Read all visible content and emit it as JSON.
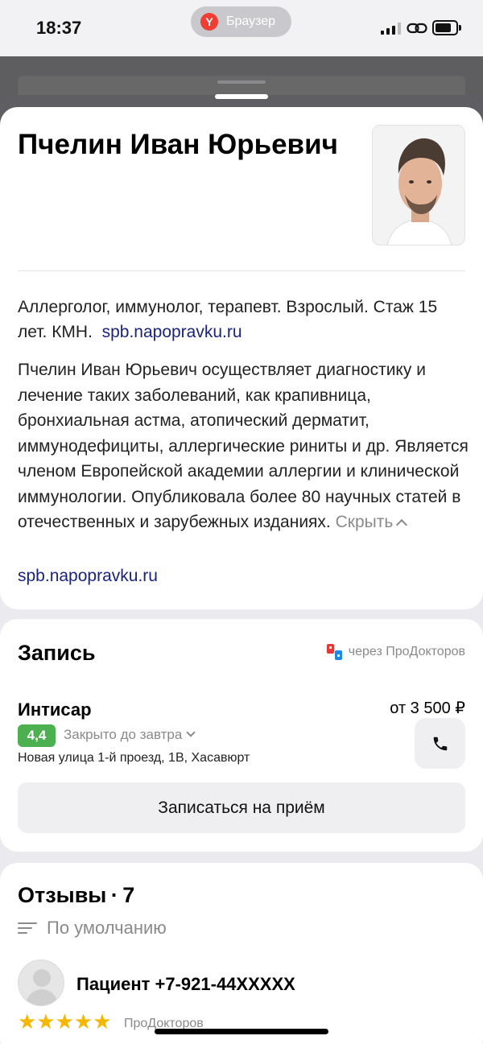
{
  "status_bar": {
    "time": "18:37",
    "browser_label": "Браузер",
    "browser_logo_letter": "Y"
  },
  "doctor": {
    "name": "Пчелин Иван Юрьевич",
    "specialty": "Аллерголог, иммунолог, терапевт. Взрослый. Стаж 15 лет. КМН.",
    "specialty_link": "spb.napopravku.ru",
    "bio": "Пчелин Иван Юрьевич осуществляет диагностику и лечение таких заболеваний, как крапивница, бронхиальная астма, атопический дерматит, иммунодефициты, аллергические риниты и др. Является членом Европейской академии аллергии и клинической иммунологии. Опубликовала более 80 научных статей в отечественных и зарубежных изданиях.",
    "hide_label": "Скрыть",
    "source_link": "spb.napopravku.ru"
  },
  "booking": {
    "title": "Запись",
    "via_label": "через ПроДокторов",
    "clinic_name": "Интисар",
    "price": "от 3 500 ₽",
    "rating": "4,4",
    "hours_status": "Закрыто до завтра",
    "address": "Новая улица 1-й проезд, 1В, Хасавюрт",
    "book_button": "Записаться на приём"
  },
  "reviews": {
    "title": "Отзывы",
    "separator": "·",
    "count": "7",
    "sort_label": "По умолчанию",
    "items": [
      {
        "author": "Пациент +7-921-44XXXXX",
        "stars": "★★★★★",
        "rating": 5,
        "source": "ПроДокторов"
      }
    ]
  },
  "colors": {
    "link": "#1a237e",
    "rating_badge": "#4caf50",
    "stars": "#f5b800",
    "muted_text": "#8a8a8a"
  }
}
